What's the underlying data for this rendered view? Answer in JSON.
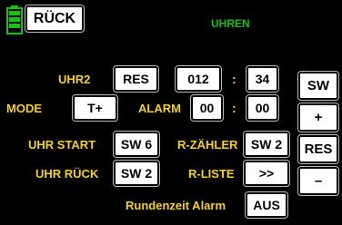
{
  "header": {
    "back_label": "RÜCK",
    "title": "UHREN"
  },
  "clock": {
    "name_label": "UHR2",
    "reset_label": "RES",
    "minutes": "012",
    "separator": ":",
    "seconds": "34"
  },
  "mode": {
    "label": "MODE",
    "value": "T+"
  },
  "alarm": {
    "label": "ALARM",
    "minutes": "00",
    "separator": ":",
    "seconds": "00"
  },
  "uhr_start": {
    "label": "UHR START",
    "value": "SW 6"
  },
  "r_zaehler": {
    "label": "R-ZÄHLER",
    "value": "SW 2"
  },
  "uhr_rueck": {
    "label": "UHR RÜCK",
    "value": "SW 2"
  },
  "r_liste": {
    "label": "R-LISTE",
    "value": ">>"
  },
  "rundenzeit": {
    "label": "Rundenzeit Alarm",
    "value": "AUS"
  },
  "side_keys": {
    "sw": "SW",
    "plus": "+",
    "res": "RES",
    "minus": "–"
  },
  "colors": {
    "background": "#000000",
    "label_yellow": "#f6d21a",
    "title_green": "#16c116",
    "button_bg": "#ffffff"
  }
}
